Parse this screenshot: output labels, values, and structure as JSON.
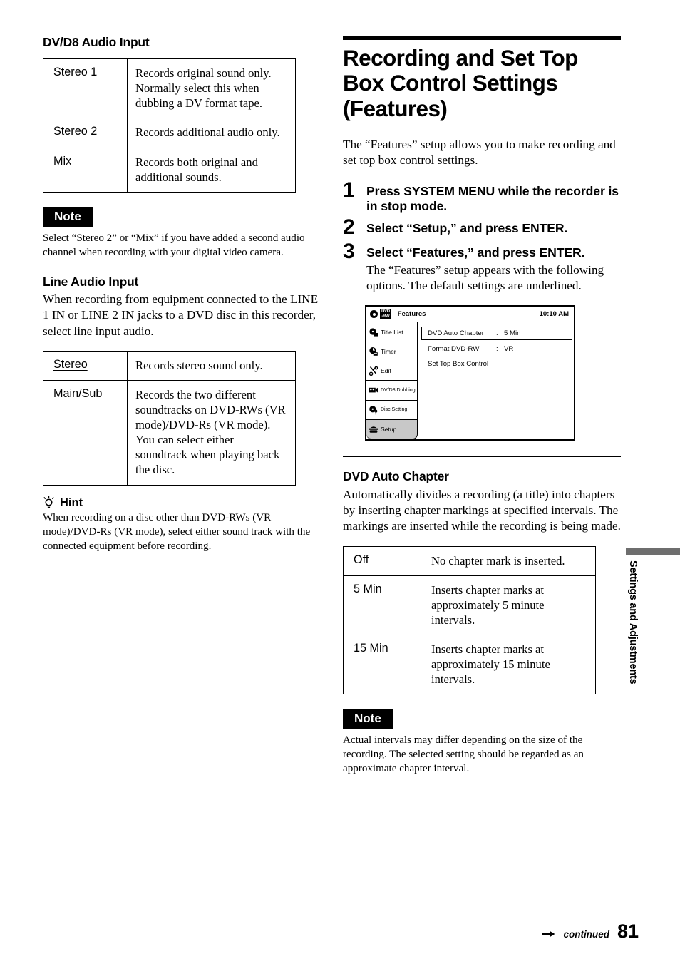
{
  "page": {
    "number": "81",
    "continued_label": "continued",
    "side_tab_label": "Settings and Adjustments"
  },
  "left_column": {
    "dv_d8": {
      "heading": "DV/D8 Audio Input",
      "rows": [
        {
          "option": "Stereo 1",
          "underlined": true,
          "description": "Records original sound only. Normally select this when dubbing a DV format tape."
        },
        {
          "option": "Stereo 2",
          "underlined": false,
          "description": "Records additional audio only."
        },
        {
          "option": "Mix",
          "underlined": false,
          "description": "Records both original and additional sounds."
        }
      ]
    },
    "note1": {
      "badge": "Note",
      "text": "Select “Stereo 2” or “Mix” if you have added a second audio channel when recording with your digital video camera."
    },
    "line_audio": {
      "heading": "Line Audio Input",
      "intro": "When recording from equipment connected to the LINE 1 IN or LINE 2 IN jacks to a DVD disc in this recorder, select line input audio.",
      "rows": [
        {
          "option": "Stereo",
          "underlined": true,
          "description": "Records stereo sound only."
        },
        {
          "option": "Main/Sub",
          "underlined": false,
          "description": "Records the two different soundtracks on DVD-RWs (VR mode)/DVD-Rs (VR mode). You can select either soundtrack when playing back the disc."
        }
      ]
    },
    "hint": {
      "label": "Hint",
      "icon": "lightbulb-icon",
      "text": "When recording on a disc other than DVD-RWs (VR mode)/DVD-Rs (VR mode), select either sound track with the connected equipment before recording."
    }
  },
  "right_column": {
    "title": "Recording and Set Top Box Control Settings (Features)",
    "intro": "The “Features” setup allows you to make recording and set top box control settings.",
    "steps": [
      {
        "num": "1",
        "title": "Press SYSTEM MENU while the recorder is in stop mode.",
        "desc": ""
      },
      {
        "num": "2",
        "title": "Select “Setup,” and press ENTER.",
        "desc": ""
      },
      {
        "num": "3",
        "title": "Select “Features,” and press ENTER.",
        "desc": "The “Features” setup appears with the following options. The default settings are underlined."
      }
    ],
    "osd": {
      "disc_badge_line1": "DVD",
      "disc_badge_line2": "-RW",
      "title": "Features",
      "clock": "10:10 AM",
      "sidebar": [
        {
          "label": "Title List",
          "icon": "title-list-icon",
          "selected": false,
          "small": false
        },
        {
          "label": "Timer",
          "icon": "timer-icon",
          "selected": false,
          "small": false
        },
        {
          "label": "Edit",
          "icon": "scissors-icon",
          "selected": false,
          "small": false
        },
        {
          "label": "DV/D8 Dubbing",
          "icon": "camcorder-icon",
          "selected": false,
          "small": true
        },
        {
          "label": "Disc Setting",
          "icon": "disc-setting-icon",
          "selected": false,
          "small": true
        },
        {
          "label": "Setup",
          "icon": "toolbox-icon",
          "selected": true,
          "small": false
        }
      ],
      "rows": [
        {
          "label": "DVD Auto Chapter",
          "separator": ":",
          "value": "5 Min",
          "highlighted": true
        },
        {
          "label": "Format DVD-RW",
          "separator": ":",
          "value": "VR",
          "highlighted": false
        },
        {
          "label": "Set Top Box Control",
          "separator": "",
          "value": "",
          "highlighted": false
        }
      ]
    },
    "auto_chapter": {
      "heading": "DVD Auto Chapter",
      "intro": "Automatically divides a recording (a title) into chapters by inserting chapter markings at specified intervals. The markings are inserted while the recording is being made.",
      "rows": [
        {
          "option": "Off",
          "underlined": false,
          "description": "No chapter mark is inserted."
        },
        {
          "option": "5 Min",
          "underlined": true,
          "description": "Inserts chapter marks at approximately 5 minute intervals."
        },
        {
          "option": "15 Min",
          "underlined": false,
          "description": "Inserts chapter marks at approximately 15 minute intervals."
        }
      ]
    },
    "note2": {
      "badge": "Note",
      "text": "Actual intervals may differ depending on the size of the recording. The selected setting should be regarded as an approximate chapter interval."
    }
  }
}
